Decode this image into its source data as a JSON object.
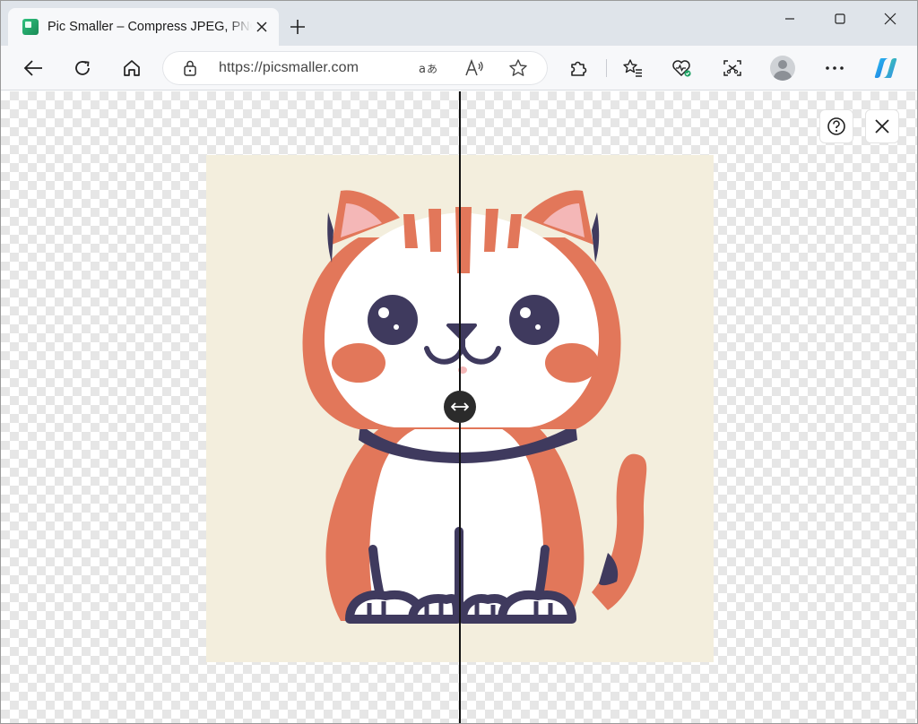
{
  "browser": {
    "tab": {
      "title": "Pic Smaller – Compress JPEG, PNG"
    },
    "address_bar": {
      "url": "https://picsmaller.com"
    }
  },
  "viewer": {
    "comparison_split_percent": 50
  },
  "colors": {
    "tabstrip_bg": "#dfe4ea",
    "toolbar_bg": "#f7f8fa",
    "image_background": "#f3eedd",
    "cat_orange": "#e2775a",
    "cat_navy": "#3f3a5e",
    "cat_pink": "#f4b7b7",
    "divider": "#111111"
  },
  "icons": {
    "favicon": "picsmaller-favicon",
    "tab_close": "close-icon",
    "new_tab": "plus-icon",
    "back": "arrow-left-icon",
    "refresh": "refresh-icon",
    "home": "home-icon",
    "lock": "lock-icon",
    "read_aloud": "read-aloud-icon",
    "favorite": "star-icon",
    "extensions": "puzzle-icon",
    "favorites": "favorites-icon",
    "health": "browser-essentials-icon",
    "screenshot": "screenshot-icon",
    "profile": "avatar",
    "more": "more-icon",
    "copilot": "copilot-icon",
    "help": "help-icon",
    "close_viewer": "close-icon",
    "slider_handle": "horizontal-arrows-icon"
  }
}
